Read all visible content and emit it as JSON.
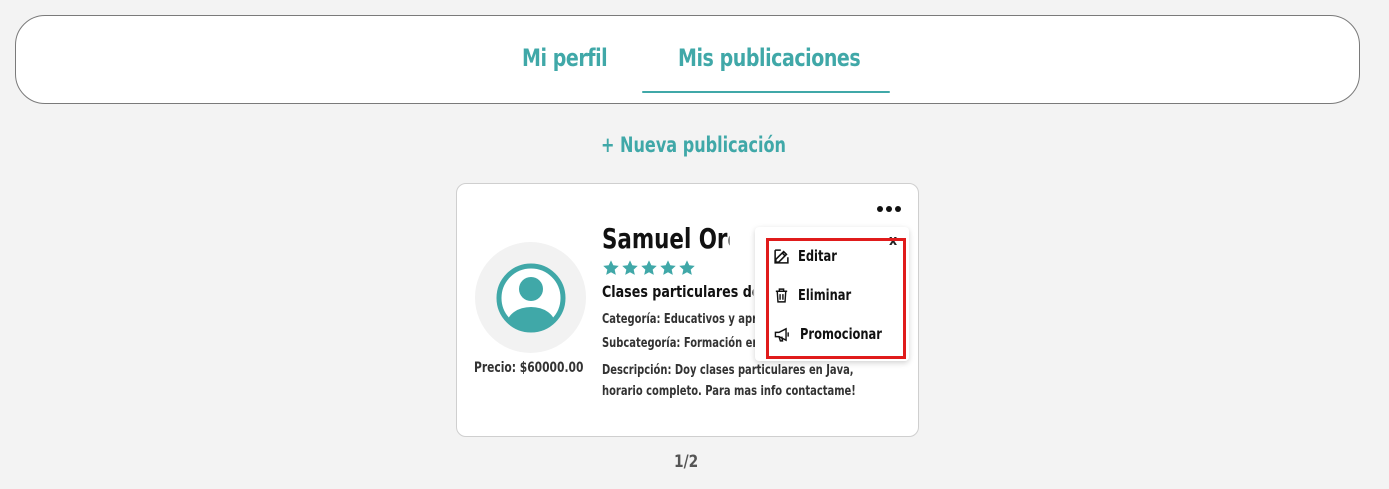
{
  "tabs": {
    "profile_label": "Mi perfil",
    "posts_label": "Mis publicaciones",
    "active": "Mis publicaciones"
  },
  "actions": {
    "new_post_label": "+ Nueva publicación"
  },
  "post": {
    "name": "Samuel Ordoñez",
    "rating": 5,
    "title": "Clases particulares de Java",
    "category": "Categoría: Educativos y aprendizaje",
    "subcategory": "Subcategoría: Formación en programación",
    "description": "Descripción: Doy clases particulares en Java, horario completo. Para mas info contactame!",
    "price": "Precio: $60000.00"
  },
  "menu": {
    "close_label": "x",
    "items": [
      {
        "label": "Editar",
        "icon": "edit-icon"
      },
      {
        "label": "Eliminar",
        "icon": "trash-icon"
      },
      {
        "label": "Promocionar",
        "icon": "megaphone-icon"
      }
    ]
  },
  "pagination": {
    "label": "1/2"
  },
  "colors": {
    "accent": "#40a8a8",
    "highlight": "#e01b1b"
  }
}
